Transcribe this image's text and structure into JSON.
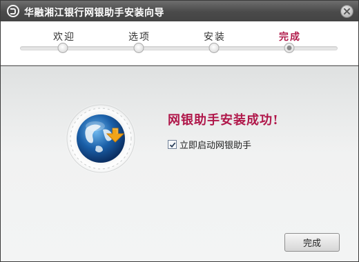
{
  "window": {
    "title": "华融湘江银行网银助手安装向导",
    "logo_icon": "bank-logo-icon",
    "close_icon": "close-icon"
  },
  "steps": [
    {
      "label": "欢迎",
      "active": false
    },
    {
      "label": "选项",
      "active": false
    },
    {
      "label": "安装",
      "active": false
    },
    {
      "label": "完成",
      "active": true
    }
  ],
  "content": {
    "illustration_icon": "globe-download-icon",
    "success_message": "网银助手安装成功!",
    "launch_checkbox": {
      "label": "立即启动网银助手",
      "checked": true
    }
  },
  "buttons": {
    "finish_label": "完成"
  },
  "colors": {
    "accent": "#b0174a",
    "titlebar": "#4a4a4a",
    "globe_blue": "#1a5fa8",
    "arrow_orange": "#f0a418"
  }
}
